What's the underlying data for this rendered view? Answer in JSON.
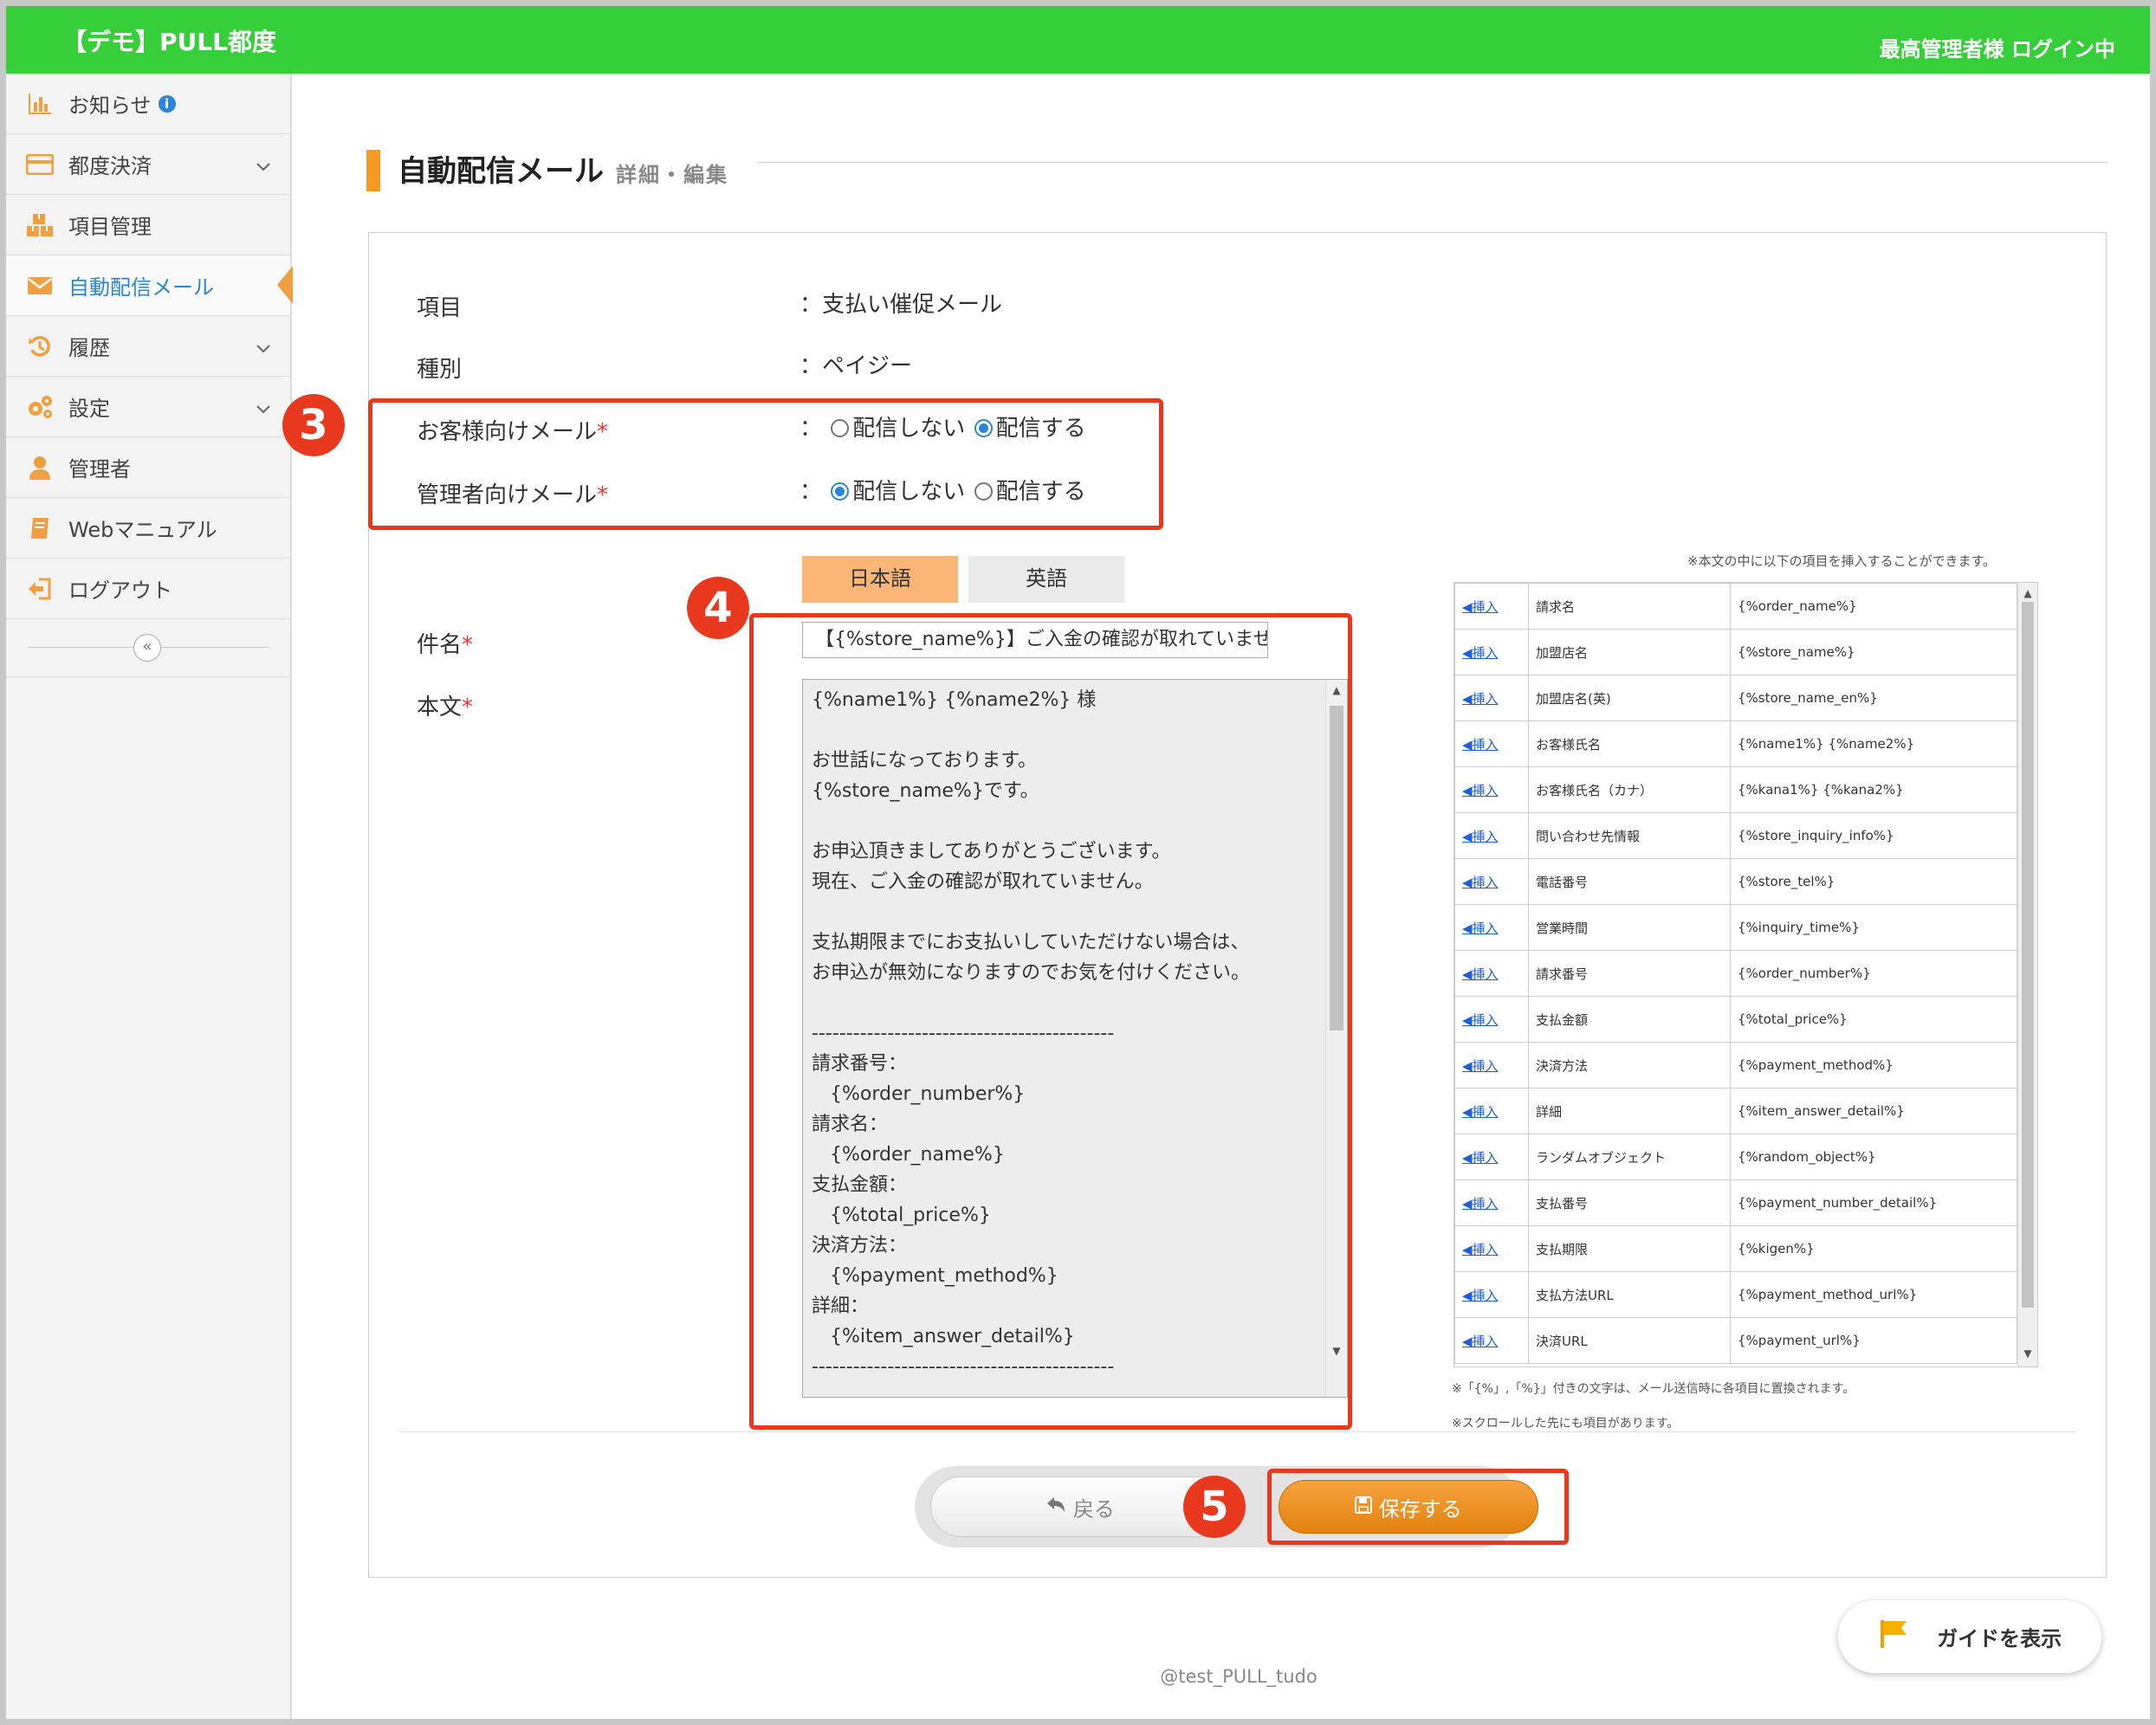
{
  "header": {
    "app_title": "【デモ】PULL都度",
    "login_status": "最高管理者様 ログイン中",
    "color": "#36cf3a"
  },
  "sidebar": {
    "items": [
      {
        "label": "お知らせ",
        "icon": "bar-chart-icon",
        "badge": "i"
      },
      {
        "label": "都度決済",
        "icon": "card-icon",
        "expandable": true
      },
      {
        "label": "項目管理",
        "icon": "boxes-icon"
      },
      {
        "label": "自動配信メール",
        "icon": "mail-icon",
        "active": true
      },
      {
        "label": "履歴",
        "icon": "history-icon",
        "expandable": true
      },
      {
        "label": "設定",
        "icon": "gears-icon",
        "expandable": true
      },
      {
        "label": "管理者",
        "icon": "user-icon"
      },
      {
        "label": "Webマニュアル",
        "icon": "book-icon"
      },
      {
        "label": "ログアウト",
        "icon": "logout-icon"
      }
    ],
    "collapse_label": "«"
  },
  "page": {
    "title": "自動配信メール",
    "subtitle": "詳細・編集"
  },
  "form": {
    "item_label": "項目",
    "item_value": "：支払い催促メール",
    "type_label": "種別",
    "type_value": "：ペイジー",
    "customer_mail_label": "お客様向けメール",
    "admin_mail_label": "管理者向けメール",
    "colon": "：",
    "opt_no_send": "配信しない",
    "opt_send": "配信する",
    "customer_mail_selected": "send",
    "admin_mail_selected": "no_send",
    "required_mark": "*",
    "tab_ja": "日本語",
    "tab_en": "英語",
    "subject_label": "件名",
    "subject_value": "【{%store_name%}】ご入金の確認が取れていませ",
    "body_label": "本文",
    "body_value": "{%name1%} {%name2%} 様\n\nお世話になっております。\n{%store_name%}です。\n\nお申込頂きましてありがとうございます。\n現在、ご入金の確認が取れていません。\n\n支払期限までにお支払いしていただけない場合は、\nお申込が無効になりますのでお気を付けください。\n\n--------------------------------------------\n請求番号：\n   {%order_number%}\n請求名：\n   {%order_name%}\n支払金額：\n   {%total_price%}\n決済方法：\n   {%payment_method%}\n詳細：\n   {%item_answer_detail%}\n--------------------------------------------\n\n---------------お支払情報---------------"
  },
  "insert_panel": {
    "note_top": "※本文の中に以下の項目を挿入することができます。",
    "insert_label": "◀挿入",
    "rows": [
      {
        "name": "請求名",
        "tag": "{%order_name%}"
      },
      {
        "name": "加盟店名",
        "tag": "{%store_name%}"
      },
      {
        "name": "加盟店名(英)",
        "tag": "{%store_name_en%}"
      },
      {
        "name": "お客様氏名",
        "tag": "{%name1%} {%name2%}"
      },
      {
        "name": "お客様氏名（カナ）",
        "tag": "{%kana1%} {%kana2%}"
      },
      {
        "name": "問い合わせ先情報",
        "tag": "{%store_inquiry_info%}"
      },
      {
        "name": "電話番号",
        "tag": "{%store_tel%}"
      },
      {
        "name": "営業時間",
        "tag": "{%inquiry_time%}"
      },
      {
        "name": "請求番号",
        "tag": "{%order_number%}"
      },
      {
        "name": "支払金額",
        "tag": "{%total_price%}"
      },
      {
        "name": "決済方法",
        "tag": "{%payment_method%}"
      },
      {
        "name": "詳細",
        "tag": "{%item_answer_detail%}"
      },
      {
        "name": "ランダムオブジェクト",
        "tag": "{%random_object%}"
      },
      {
        "name": "支払番号",
        "tag": "{%payment_number_detail%}"
      },
      {
        "name": "支払期限",
        "tag": "{%kigen%}"
      },
      {
        "name": "支払方法URL",
        "tag": "{%payment_method_url%}"
      },
      {
        "name": "決済URL",
        "tag": "{%payment_url%}"
      }
    ],
    "note_bottom1": "※「{%」,「%}」付きの文字は、メール送信時に各項目に置換されます。",
    "note_bottom2": "※スクロールした先にも項目があります。"
  },
  "buttons": {
    "back_label": "戻る",
    "save_label": "保存する"
  },
  "annotations": [
    "3",
    "4",
    "5"
  ],
  "guide_button": "ガイドを表示",
  "footer": "@test_PULL_tudo",
  "colors": {
    "accent_orange": "#f59a23",
    "annotation_red": "#e8391f",
    "link_blue": "#2b86d8"
  }
}
